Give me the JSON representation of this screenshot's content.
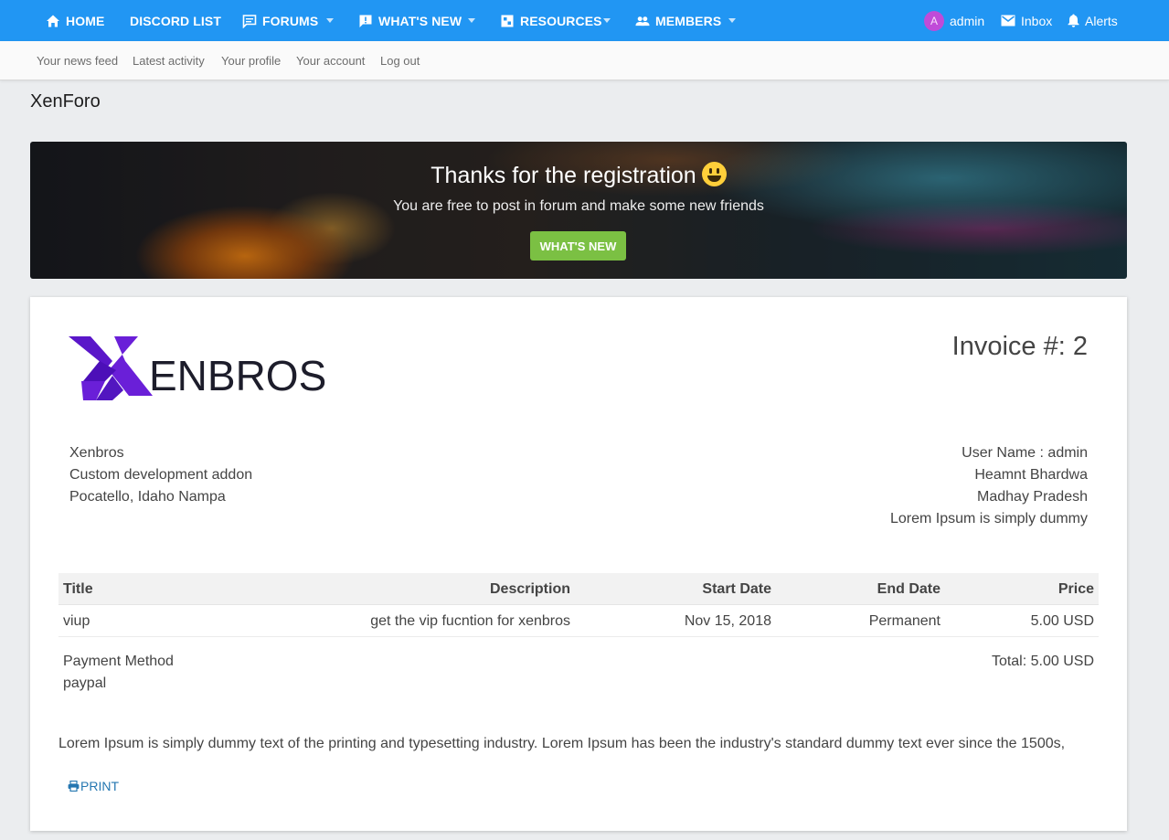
{
  "nav": {
    "home": "HOME",
    "discord": "DISCORD LIST",
    "forums": "FORUMS",
    "whats_new": "WHAT'S NEW",
    "resources": "RESOURCES",
    "members": "MEMBERS",
    "user_initial": "A",
    "user": "admin",
    "inbox": "Inbox",
    "alerts": "Alerts",
    "icons": [
      "home-icon",
      "forums-icon",
      "whats-new-icon",
      "resources-icon",
      "members-icon",
      "inbox-icon",
      "bell-icon"
    ]
  },
  "subnav": [
    "Your news feed",
    "Latest activity",
    "Your profile",
    "Your account",
    "Log out"
  ],
  "page_title": "XenForo",
  "banner": {
    "title": "Thanks for the registration",
    "subtitle": "You are free to post in forum and make some new friends",
    "button": "WHAT'S NEW"
  },
  "invoice": {
    "brand": "ENBROS",
    "number_label": "Invoice #: 2",
    "from": [
      "Xenbros",
      "Custom development addon",
      "Pocatello, Idaho Nampa"
    ],
    "to": [
      "User Name : admin",
      "Heamnt Bhardwa",
      "Madhay Pradesh",
      "Lorem Ipsum is simply dummy"
    ],
    "headers": {
      "title": "Title",
      "description": "Description",
      "start": "Start Date",
      "end": "End Date",
      "price": "Price"
    },
    "row": {
      "title": "viup",
      "description": "get the vip fucntion for xenbros",
      "start": "Nov 15, 2018",
      "end": "Permanent",
      "price": "5.00 USD"
    },
    "payment_label": "Payment Method",
    "payment_value": "paypal",
    "total": "Total: 5.00 USD",
    "note": "Lorem Ipsum is simply dummy text of the printing and typesetting industry. Lorem Ipsum has been the industry's standard dummy text ever since the 1500s,",
    "print": "PRINT"
  },
  "colors": {
    "nav": "#2196f3",
    "button": "#7bc043",
    "brand": "#6a1fd8",
    "link": "#2577b1"
  }
}
